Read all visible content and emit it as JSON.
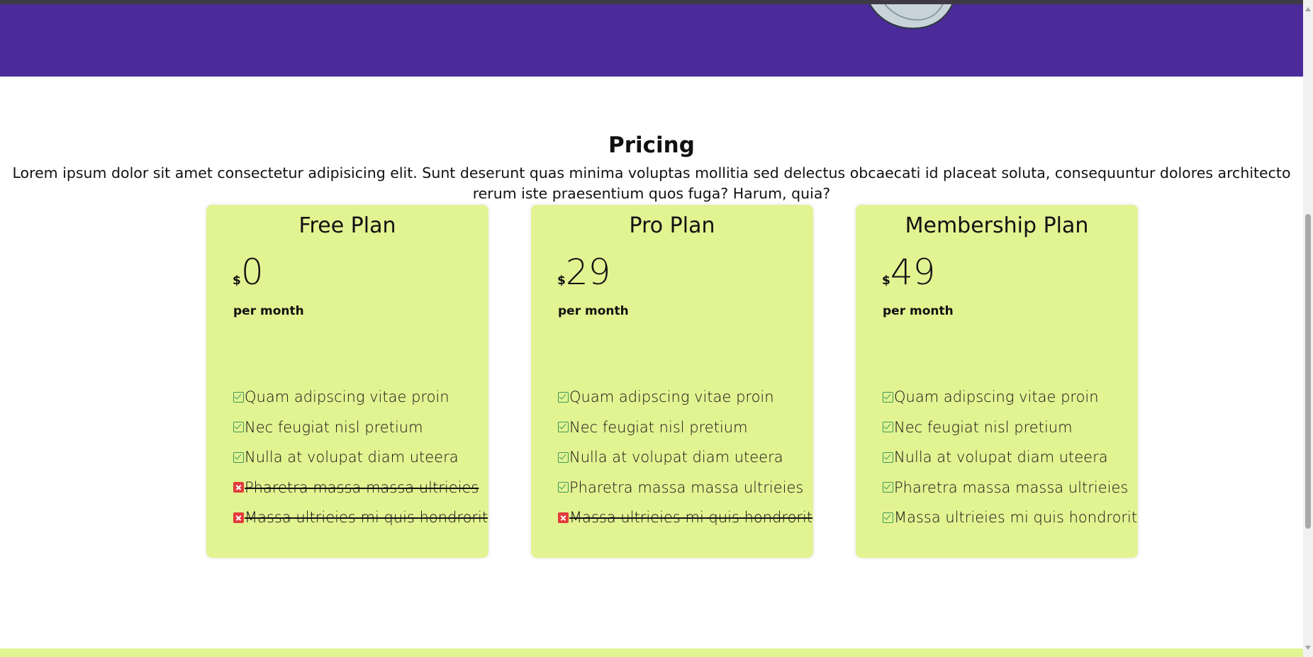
{
  "pricing": {
    "title": "Pricing",
    "description": "Lorem ipsum dolor sit amet consectetur adipisicing elit. Sunt deserunt quas minima voluptas mollitia sed delectus obcaecati id placeat soluta, consequuntur dolores architecto rerum iste praesentium quos fuga? Harum, quia?"
  },
  "colors": {
    "hero_band": "#4b2a99",
    "card_background": "#e2f392",
    "check_icon": "#3b9a57",
    "cross_icon": "#e23b3b"
  },
  "plans": [
    {
      "name": "Free Plan",
      "currency": "$",
      "amount": "0",
      "period": "per month",
      "features": [
        {
          "label": "Quam adipscing vitae proin",
          "included": true,
          "icon": "check-icon"
        },
        {
          "label": "Nec feugiat nisl pretium",
          "included": true,
          "icon": "check-icon"
        },
        {
          "label": "Nulla at volupat diam uteera",
          "included": true,
          "icon": "check-icon"
        },
        {
          "label": "Pharetra massa massa ultrieies",
          "included": false,
          "icon": "cross-icon"
        },
        {
          "label": "Massa ultrieies mi quis hondrorit",
          "included": false,
          "icon": "cross-icon"
        }
      ]
    },
    {
      "name": "Pro Plan",
      "currency": "$",
      "amount": "29",
      "period": "per month",
      "features": [
        {
          "label": "Quam adipscing vitae proin",
          "included": true,
          "icon": "check-icon"
        },
        {
          "label": "Nec feugiat nisl pretium",
          "included": true,
          "icon": "check-icon"
        },
        {
          "label": "Nulla at volupat diam uteera",
          "included": true,
          "icon": "check-icon"
        },
        {
          "label": "Pharetra massa massa ultrieies",
          "included": true,
          "icon": "check-icon"
        },
        {
          "label": "Massa ultrieies mi quis hondrorit",
          "included": false,
          "icon": "cross-icon"
        }
      ]
    },
    {
      "name": "Membership Plan",
      "currency": "$",
      "amount": "49",
      "period": "per month",
      "features": [
        {
          "label": "Quam adipscing vitae proin",
          "included": true,
          "icon": "check-icon"
        },
        {
          "label": "Nec feugiat nisl pretium",
          "included": true,
          "icon": "check-icon"
        },
        {
          "label": "Nulla at volupat diam uteera",
          "included": true,
          "icon": "check-icon"
        },
        {
          "label": "Pharetra massa massa ultrieies",
          "included": true,
          "icon": "check-icon"
        },
        {
          "label": "Massa ultrieies mi quis hondrorit",
          "included": true,
          "icon": "check-icon"
        }
      ]
    }
  ]
}
